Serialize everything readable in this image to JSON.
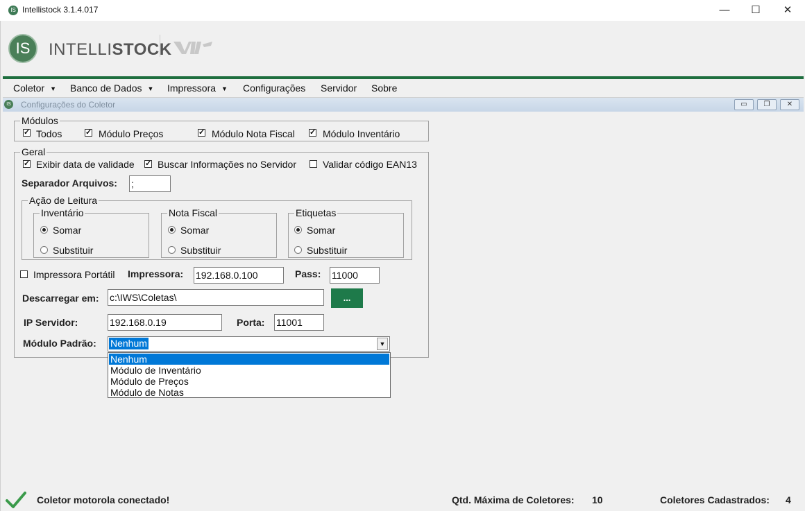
{
  "window": {
    "title": "Intellistock 3.1.4.017",
    "app_icon": "IS"
  },
  "window_controls": {
    "minimize": "—",
    "maximize": "☐",
    "close": "✕"
  },
  "header": {
    "brand_light": "INTELLI",
    "brand_bold": "STOCK",
    "logo_letters": "IS"
  },
  "menu": [
    {
      "label": "Coletor",
      "arrow": "▼"
    },
    {
      "label": "Banco de Dados",
      "arrow": "▼"
    },
    {
      "label": "Impressora",
      "arrow": "▼"
    },
    {
      "label": "Configurações"
    },
    {
      "label": "Servidor"
    },
    {
      "label": "Sobre"
    }
  ],
  "inner_window": {
    "title": "Configurações do Coletor",
    "icon": "IS"
  },
  "modulos": {
    "legend": "Módulos",
    "items": [
      {
        "label": "Todos",
        "checked": true
      },
      {
        "label": "Módulo Preços",
        "checked": true
      },
      {
        "label": "Módulo Nota Fiscal",
        "checked": true
      },
      {
        "label": "Módulo Inventário",
        "checked": true
      }
    ]
  },
  "geral": {
    "legend": "Geral",
    "options": [
      {
        "label": "Exibir data de validade",
        "checked": true
      },
      {
        "label": "Buscar Informações no Servidor",
        "checked": true
      },
      {
        "label": "Validar código EAN13",
        "checked": false
      }
    ],
    "separador_label": "Separador Arquivos:",
    "separador_value": ";",
    "acao_leitura": {
      "legend": "Ação de Leitura",
      "groups": [
        {
          "legend": "Inventário",
          "options": [
            "Somar",
            "Substituir"
          ],
          "selected": "Somar"
        },
        {
          "legend": "Nota Fiscal",
          "options": [
            "Somar",
            "Substituir"
          ],
          "selected": "Somar"
        },
        {
          "legend": "Etiquetas",
          "options": [
            "Somar",
            "Substituir"
          ],
          "selected": "Somar"
        }
      ]
    },
    "impressora_portatil_label": "Impressora Portátil",
    "impressora_portatil_checked": false,
    "impressora_label": "Impressora:",
    "impressora_value": "192.168.0.100",
    "pass_label": "Pass:",
    "pass_value": "11000",
    "descarregar_label": "Descarregar em:",
    "descarregar_value": "c:\\IWS\\Coletas\\",
    "browse_label": "...",
    "ip_label": "IP Servidor:",
    "ip_value": "192.168.0.19",
    "porta_label": "Porta:",
    "porta_value": "11001",
    "modulo_padrao_label": "Módulo Padrão:",
    "modulo_padrao_value": "Nenhum",
    "modulo_padrao_options": [
      "Nenhum",
      "Módulo de Inventário",
      "Módulo de Preços",
      "Módulo de Notas"
    ]
  },
  "status": {
    "message": "Coletor motorola conectado!",
    "max_label": "Qtd. Máxima de Coletores:",
    "max_value": "10",
    "cadastrados_label": "Coletores Cadastrados:",
    "cadastrados_value": "4"
  },
  "colors": {
    "brand_green": "#1e6e3e",
    "button_green": "#1e7a4a",
    "selection_blue": "#0078d7"
  }
}
